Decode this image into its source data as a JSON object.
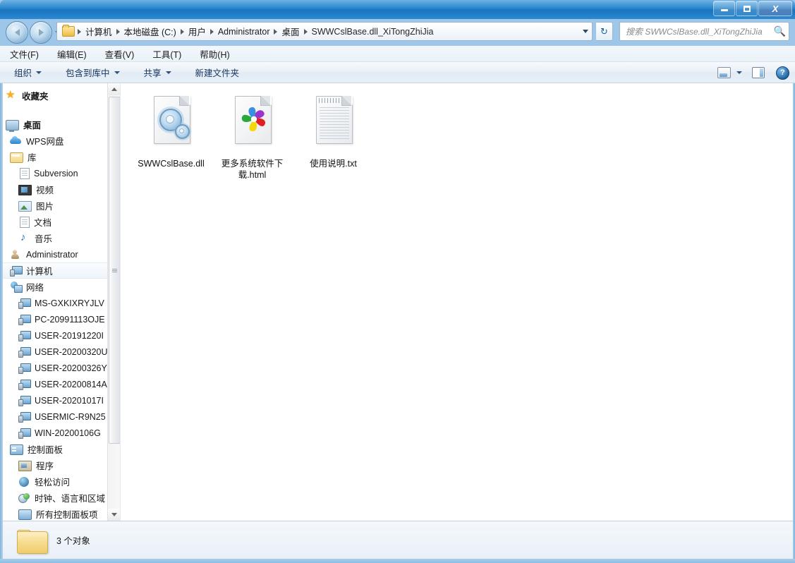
{
  "window": {
    "controls": {
      "minimize": "minimize-button",
      "maximize": "maximize-button",
      "close": "close-button"
    }
  },
  "address": {
    "breadcrumbs": [
      "计算机",
      "本地磁盘 (C:)",
      "用户",
      "Administrator",
      "桌面",
      "SWWCslBase.dll_XiTongZhiJia"
    ],
    "refresh_glyph": "↻"
  },
  "search": {
    "placeholder": "搜索 SWWCslBase.dll_XiTongZhiJia",
    "icon": "search-icon"
  },
  "menubar": {
    "items": [
      "文件(F)",
      "编辑(E)",
      "查看(V)",
      "工具(T)",
      "帮助(H)"
    ]
  },
  "toolbar": {
    "items": [
      {
        "label": "组织",
        "caret": true
      },
      {
        "label": "包含到库中",
        "caret": true
      },
      {
        "label": "共享",
        "caret": true
      },
      {
        "label": "新建文件夹",
        "caret": false
      }
    ],
    "right_icons": [
      "view-options-icon",
      "preview-pane-icon",
      "help-icon"
    ],
    "help_glyph": "?"
  },
  "sidebar": {
    "items": [
      {
        "label": "收藏夹",
        "icon": "star-icon",
        "indent": 0,
        "group": true,
        "selected": false
      },
      {
        "label": "",
        "icon": "",
        "indent": 0,
        "spacer": true
      },
      {
        "label": "桌面",
        "icon": "desktop-icon",
        "indent": 0,
        "group": true,
        "selected": false
      },
      {
        "label": "WPS网盘",
        "icon": "cloud-icon",
        "indent": 1,
        "selected": false
      },
      {
        "label": "库",
        "icon": "library-icon",
        "indent": 1,
        "selected": false
      },
      {
        "label": "Subversion",
        "icon": "document-icon",
        "indent": 2,
        "selected": false
      },
      {
        "label": "视频",
        "icon": "video-icon",
        "indent": 2,
        "selected": false
      },
      {
        "label": "图片",
        "icon": "picture-icon",
        "indent": 2,
        "selected": false
      },
      {
        "label": "文档",
        "icon": "document-icon",
        "indent": 2,
        "selected": false
      },
      {
        "label": "音乐",
        "icon": "music-icon",
        "indent": 2,
        "selected": false
      },
      {
        "label": "Administrator",
        "icon": "user-icon",
        "indent": 1,
        "selected": false
      },
      {
        "label": "计算机",
        "icon": "computer-icon",
        "indent": 1,
        "selected": true
      },
      {
        "label": "网络",
        "icon": "network-icon",
        "indent": 1,
        "selected": false
      },
      {
        "label": "MS-GXKIXRYJLV",
        "icon": "network-computer-icon",
        "indent": 2,
        "selected": false
      },
      {
        "label": "PC-20991113OJE",
        "icon": "network-computer-icon",
        "indent": 2,
        "selected": false
      },
      {
        "label": "USER-20191220I",
        "icon": "network-computer-icon",
        "indent": 2,
        "selected": false
      },
      {
        "label": "USER-20200320U",
        "icon": "network-computer-icon",
        "indent": 2,
        "selected": false
      },
      {
        "label": "USER-20200326Y",
        "icon": "network-computer-icon",
        "indent": 2,
        "selected": false
      },
      {
        "label": "USER-20200814A",
        "icon": "network-computer-icon",
        "indent": 2,
        "selected": false
      },
      {
        "label": "USER-20201017I",
        "icon": "network-computer-icon",
        "indent": 2,
        "selected": false
      },
      {
        "label": "USERMIC-R9N25",
        "icon": "network-computer-icon",
        "indent": 2,
        "selected": false
      },
      {
        "label": "WIN-20200106G",
        "icon": "network-computer-icon",
        "indent": 2,
        "selected": false
      },
      {
        "label": "控制面板",
        "icon": "control-panel-icon",
        "indent": 1,
        "selected": false
      },
      {
        "label": "程序",
        "icon": "programs-icon",
        "indent": 2,
        "selected": false
      },
      {
        "label": "轻松访问",
        "icon": "ease-of-access-icon",
        "indent": 2,
        "selected": false
      },
      {
        "label": "时钟、语言和区域",
        "icon": "clock-language-icon",
        "indent": 2,
        "selected": false
      },
      {
        "label": "所有控制面板项",
        "icon": "control-panel-icon",
        "indent": 2,
        "selected": false
      }
    ]
  },
  "files": [
    {
      "name": "SWWCslBase.dll",
      "icon": "dll-gear-icon",
      "type": "dll"
    },
    {
      "name": "更多系统软件下载.html",
      "icon": "html-pinwheel-icon",
      "type": "html"
    },
    {
      "name": "使用说明.txt",
      "icon": "text-document-icon",
      "type": "txt"
    }
  ],
  "statusbar": {
    "text": "3 个对象",
    "icon": "folder-icon"
  },
  "colors": {
    "titlebar": "#1e7ec9",
    "frame": "#9fc7e9",
    "accent": "#2a63a8",
    "pinwheel": [
      "#9b34c9",
      "#e02020",
      "#f5d808",
      "#2aa83a",
      "#3a8fe0"
    ]
  }
}
